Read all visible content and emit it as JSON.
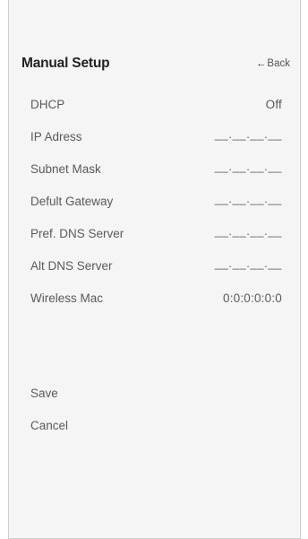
{
  "header": {
    "title": "Manual Setup",
    "back_label": "Back",
    "back_icon": "left-arrow-icon"
  },
  "settings": [
    {
      "label": "DHCP",
      "value": "Off"
    },
    {
      "label": "IP Adress",
      "value": "__.__.__.__"
    },
    {
      "label": "Subnet Mask",
      "value": "__.__.__.__"
    },
    {
      "label": "Defult Gateway",
      "value": "__.__.__.__"
    },
    {
      "label": "Pref. DNS Server",
      "value": "__.__.__.__"
    },
    {
      "label": "Alt DNS Server",
      "value": "__.__.__.__"
    },
    {
      "label": "Wireless Mac",
      "value": "0:0:0:0:0:0"
    }
  ],
  "actions": {
    "save_label": "Save",
    "cancel_label": "Cancel"
  }
}
